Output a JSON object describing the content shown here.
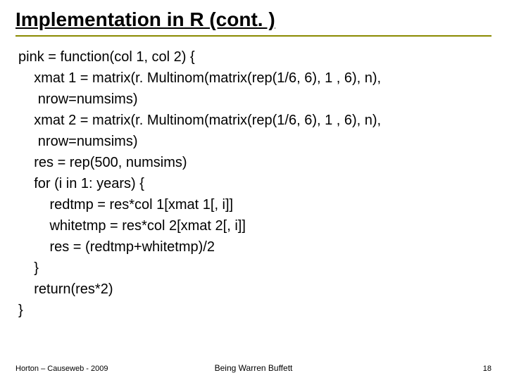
{
  "title": "Implementation in R (cont. )",
  "code": {
    "l1": "pink = function(col 1, col 2) {",
    "l2": "    xmat 1 = matrix(r. Multinom(matrix(rep(1/6, 6), 1 , 6), n),",
    "l3": "     nrow=numsims)",
    "l4": "    xmat 2 = matrix(r. Multinom(matrix(rep(1/6, 6), 1 , 6), n),",
    "l5": "     nrow=numsims)",
    "l6": "    res = rep(500, numsims)",
    "l7": "    for (i in 1: years) {",
    "l8": "        redtmp = res*col 1[xmat 1[, i]]",
    "l9": "        whitetmp = res*col 2[xmat 2[, i]]",
    "l10": "        res = (redtmp+whitetmp)/2",
    "l11": "    }",
    "l12": "    return(res*2)",
    "l13": "}"
  },
  "footer": {
    "left": "Horton – Causeweb - 2009",
    "center": "Being Warren Buffett",
    "right": "18"
  }
}
